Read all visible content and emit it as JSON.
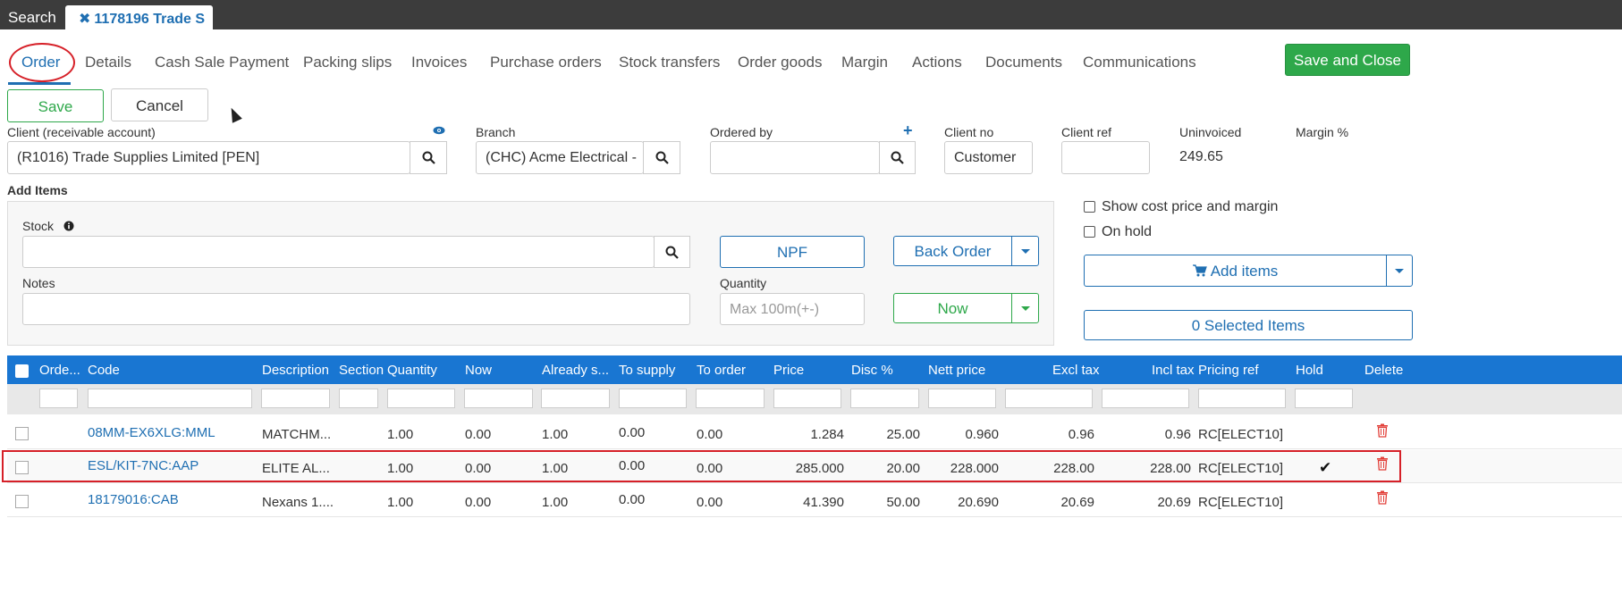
{
  "topbar": {
    "search_label": "Search",
    "doc_tab_label": "1178196 Trade S"
  },
  "tabs": [
    "Order",
    "Details",
    "Cash Sale Payment",
    "Packing slips",
    "Invoices",
    "Purchase orders",
    "Stock transfers",
    "Order goods",
    "Margin",
    "Actions",
    "Documents",
    "Communications"
  ],
  "buttons": {
    "save_close": "Save and Close",
    "save": "Save",
    "cancel": "Cancel",
    "npf": "NPF",
    "back_order": "Back Order",
    "now": "Now",
    "add_items": "Add items",
    "selected_items": "0 Selected Items"
  },
  "header_fields": {
    "client_label": "Client (receivable account)",
    "client_value": "(R1016) Trade Supplies Limited [PEN]",
    "branch_label": "Branch",
    "branch_value": "(CHC) Acme Electrical -",
    "ordered_by_label": "Ordered by",
    "ordered_by_value": "",
    "client_no_label": "Client no",
    "client_no_value": "Customer",
    "client_ref_label": "Client ref",
    "client_ref_value": "",
    "uninvoiced_label": "Uninvoiced",
    "uninvoiced_value": "249.65",
    "margin_label": "Margin %"
  },
  "add_items": {
    "section_title": "Add Items",
    "stock_label": "Stock",
    "notes_label": "Notes",
    "quantity_label": "Quantity",
    "quantity_placeholder": "Max 100m(+-)",
    "show_cost_label": "Show cost price and margin",
    "on_hold_label": "On hold"
  },
  "grid": {
    "columns": [
      "Orde...",
      "Code",
      "Description",
      "Section",
      "Quantity",
      "Now",
      "Already s...",
      "To supply",
      "To order",
      "Price",
      "Disc %",
      "Nett price",
      "Excl tax",
      "Incl tax",
      "Pricing ref",
      "Hold",
      "Delete"
    ],
    "rows": [
      {
        "code": "08MM-EX6XLG:MML",
        "description": "MATCHM...",
        "section": "",
        "quantity": "1.00",
        "now": "0.00",
        "already": "1.00",
        "to_supply": "0.00",
        "to_order": "0.00",
        "price": "1.284",
        "disc": "25.00",
        "nett": "0.960",
        "excl": "0.96",
        "incl": "0.96",
        "pricing_ref": "RC[ELECT10]",
        "hold": ""
      },
      {
        "code": "ESL/KIT-7NC:AAP",
        "description": "ELITE AL...",
        "section": "",
        "quantity": "1.00",
        "now": "0.00",
        "already": "1.00",
        "to_supply": "0.00",
        "to_order": "0.00",
        "price": "285.000",
        "disc": "20.00",
        "nett": "228.000",
        "excl": "228.00",
        "incl": "228.00",
        "pricing_ref": "RC[ELECT10]",
        "hold": "✔"
      },
      {
        "code": "18179016:CAB",
        "description": "Nexans 1....",
        "section": "",
        "quantity": "1.00",
        "now": "0.00",
        "already": "1.00",
        "to_supply": "0.00",
        "to_order": "0.00",
        "price": "41.390",
        "disc": "50.00",
        "nett": "20.690",
        "excl": "20.69",
        "incl": "20.69",
        "pricing_ref": "RC[ELECT10]",
        "hold": ""
      }
    ]
  },
  "colors": {
    "primary": "#1976d2",
    "link": "#1f6fb2",
    "success": "#2ea84a",
    "danger": "#d62028",
    "topbar": "#3c3c3c"
  },
  "icons": [
    "close-icon",
    "eye-icon",
    "plus-icon",
    "search-icon",
    "info-icon",
    "cart-icon",
    "caret-down-icon",
    "checkmark-icon",
    "trash-icon"
  ]
}
